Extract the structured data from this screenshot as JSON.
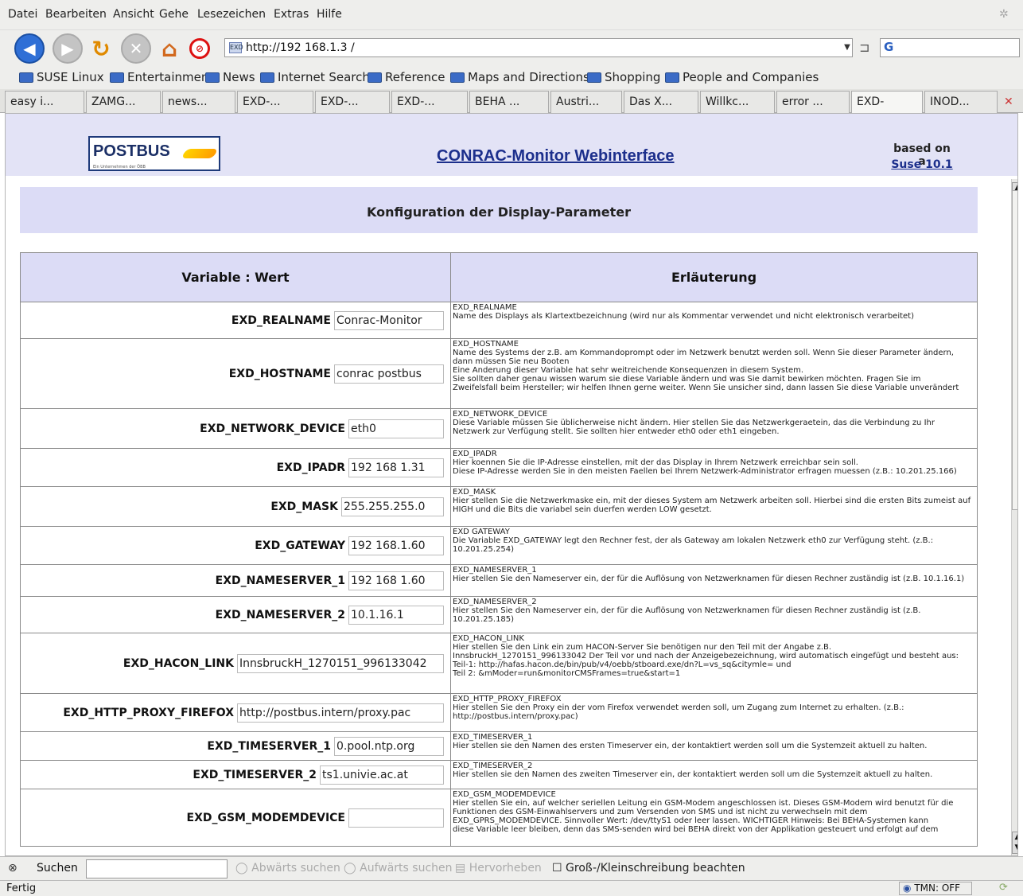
{
  "menubar": {
    "items": [
      "Datei",
      "Bearbeiten",
      "Ansicht",
      "Gehe",
      "Lesezeichen",
      "Extras",
      "Hilfe"
    ]
  },
  "navbar": {
    "url": "http://192 168.1.3 /"
  },
  "bookmarks": [
    "SUSE Linux",
    "Entertainment",
    "News",
    "Internet Search",
    "Reference",
    "Maps and Directions",
    "Shopping",
    "People and Companies"
  ],
  "tabs": [
    "easy i...",
    "ZAMG...",
    "news...",
    "EXD-...",
    "EXD-...",
    "EXD-...",
    "BEHA ...",
    "Austri...",
    "Das X...",
    "Willkc...",
    "error ...",
    "EXD-",
    "INOD..."
  ],
  "header": {
    "logo_text": "POSTBUS",
    "logo_sub": "Ein Unternehmen der ÖBB",
    "title": "CONRAC-Monitor Webinterface",
    "based_on": "based on a",
    "suse_link": "Suse 10.1"
  },
  "page_title": "Konfiguration der Display-Parameter",
  "table": {
    "col1": "Variable : Wert",
    "col2": "Erläuterung",
    "rows": [
      {
        "name": "EXD_REALNAME",
        "value": "Conrac-Monitor",
        "expl": [
          "EXD_REALNAME",
          "Name des Displays als Klartextbezeichnung (wird nur als Kommentar verwendet und nicht elektronisch verarbeitet)"
        ]
      },
      {
        "name": "EXD_HOSTNAME",
        "value": "conrac postbus",
        "expl": [
          "EXD_HOSTNAME",
          "Name des Systems der z.B. am Kommandoprompt oder im Netzwerk benutzt werden soll. Wenn Sie dieser Parameter ändern,",
          "dann müssen Sie neu Booten",
          "Eine Änderung dieser Variable hat sehr weitreichende Konsequenzen in diesem System.",
          "Sie sollten daher genau wissen warum sie diese Variable ändern und was Sie damit bewirken möchten. Fragen Sie im",
          "Zweifelsfall beim Hersteller; wir helfen Ihnen gerne weiter. Wenn Sie unsicher sind, dann lassen Sie diese Variable unverändert"
        ]
      },
      {
        "name": "EXD_NETWORK_DEVICE",
        "value": "eth0",
        "expl": [
          "EXD_NETWORK_DEVICE",
          "Diese Variable müssen Sie üblicherweise nicht ändern. Hier stellen Sie das Netzwerkgeraetein, das die Verbindung zu Ihr",
          "Netzwerk zur Verfügung stellt. Sie sollten hier entweder eth0 oder eth1 eingeben."
        ]
      },
      {
        "name": "EXD_IPADR",
        "value": "192 168 1.31",
        "expl": [
          "EXD_IPADR",
          "Hier koennen Sie die IP-Adresse einstellen, mit der das Display in Ihrem Netzwerk erreichbar sein soll.",
          "Diese IP-Adresse werden Sie in den meisten Faellen bei Ihrem Netzwerk-Administrator erfragen muessen (z.B.: 10.201.25.166)"
        ]
      },
      {
        "name": "EXD_MASK",
        "value": "255.255.255.0",
        "expl": [
          "EXD_MASK",
          "Hier stellen Sie die Netzwerkmaske ein, mit der dieses System am Netzwerk arbeiten soll. Hierbei sind die ersten Bits zumeist auf",
          "HIGH und die Bits die variabel sein duerfen werden LOW gesetzt."
        ]
      },
      {
        "name": "EXD_GATEWAY",
        "value": "192 168.1.60",
        "expl": [
          "EXD GATEWAY",
          "Die Variable EXD_GATEWAY legt den Rechner fest, der als Gateway am lokalen Netzwerk eth0 zur Verfügung steht. (z.B.:",
          "10.201.25.254)"
        ]
      },
      {
        "name": "EXD_NAMESERVER_1",
        "value": "192 168 1.60",
        "expl": [
          "EXD_NAMESERVER_1",
          "Hier stellen Sie den Nameserver ein, der für die Auflösung von Netzwerknamen für diesen Rechner zuständig ist (z.B. 10.1.16.1)"
        ]
      },
      {
        "name": "EXD_NAMESERVER_2",
        "value": "10.1.16.1",
        "expl": [
          "EXD_NAMESERVER_2",
          "Hier stellen Sie den Nameserver ein, der für die Auflösung von Netzwerknamen für diesen Rechner zuständig ist (z.B.",
          "10.201.25.185)"
        ]
      },
      {
        "name": "EXD_HACON_LINK",
        "value": "InnsbruckH_1270151_996133042",
        "expl": [
          "EXD_HACON_LINK",
          "Hier stellen Sie den Link ein zum HACON-Server Sie benötigen nur den Teil mit der Angabe z.B.",
          "InnsbruckH_1270151_996133042 Der Teil vor und nach der Anzeigebezeichnung, wird automatisch eingefügt und besteht aus:",
          "Teil-1: http://hafas.hacon.de/bin/pub/v4/oebb/stboard.exe/dn?L=vs_sq&citymle= und",
          "Teil 2: &mModer=run&monitorCMSFrames=true&start=1"
        ]
      },
      {
        "name": "EXD_HTTP_PROXY_FIREFOX",
        "value": "http://postbus.intern/proxy.pac",
        "expl": [
          "EXD_HTTP_PROXY_FIREFOX",
          "Hier stellen Sie den Proxy ein der vom Firefox verwendet werden soll, um Zugang zum Internet zu erhalten. (z.B.:",
          "http://postbus.intern/proxy.pac)"
        ]
      },
      {
        "name": "EXD_TIMESERVER_1",
        "value": "0.pool.ntp.org",
        "expl": [
          "EXD_TIMESERVER_1",
          "Hier stellen sie den Namen des ersten Timeserver ein, der kontaktiert werden soll um die Systemzeit aktuell zu halten."
        ]
      },
      {
        "name": "EXD_TIMESERVER_2",
        "value": "ts1.univie.ac.at",
        "expl": [
          "EXD_TIMESERVER_2",
          "Hier stellen sie den Namen des zweiten Timeserver ein, der kontaktiert werden soll um die Systemzeit aktuell zu halten."
        ]
      },
      {
        "name": "EXD_GSM_MODEMDEVICE",
        "value": "",
        "expl": [
          "EXD_GSM_MODEMDEVICE",
          "Hier stellen Sie ein, auf welcher seriellen Leitung ein GSM-Modem angeschlossen ist. Dieses GSM-Modem wird benutzt für die",
          "Funktionen des GSM-Einwahlservers und zum Versenden von SMS und ist nicht zu verwechseln mit dem",
          "EXD_GPRS_MODEMDEVICE. Sinnvoller Wert: /dev/ttyS1 oder leer lassen. WICHTIGER Hinweis: Bei BEHA-Systemen kann",
          "diese Variable leer bleiben, denn das SMS-senden wird bei BEHA direkt von der Applikation gesteuert und erfolgt auf dem"
        ]
      }
    ]
  },
  "findbar": {
    "label": "Suchen",
    "down": "Abwärts suchen",
    "up": "Aufwärts suchen",
    "highlight": "Hervorheben",
    "case": "Groß-/Kleinschreibung beachten"
  },
  "statusbar": {
    "text": "Fertig",
    "tmn": "TMN: OFF"
  }
}
